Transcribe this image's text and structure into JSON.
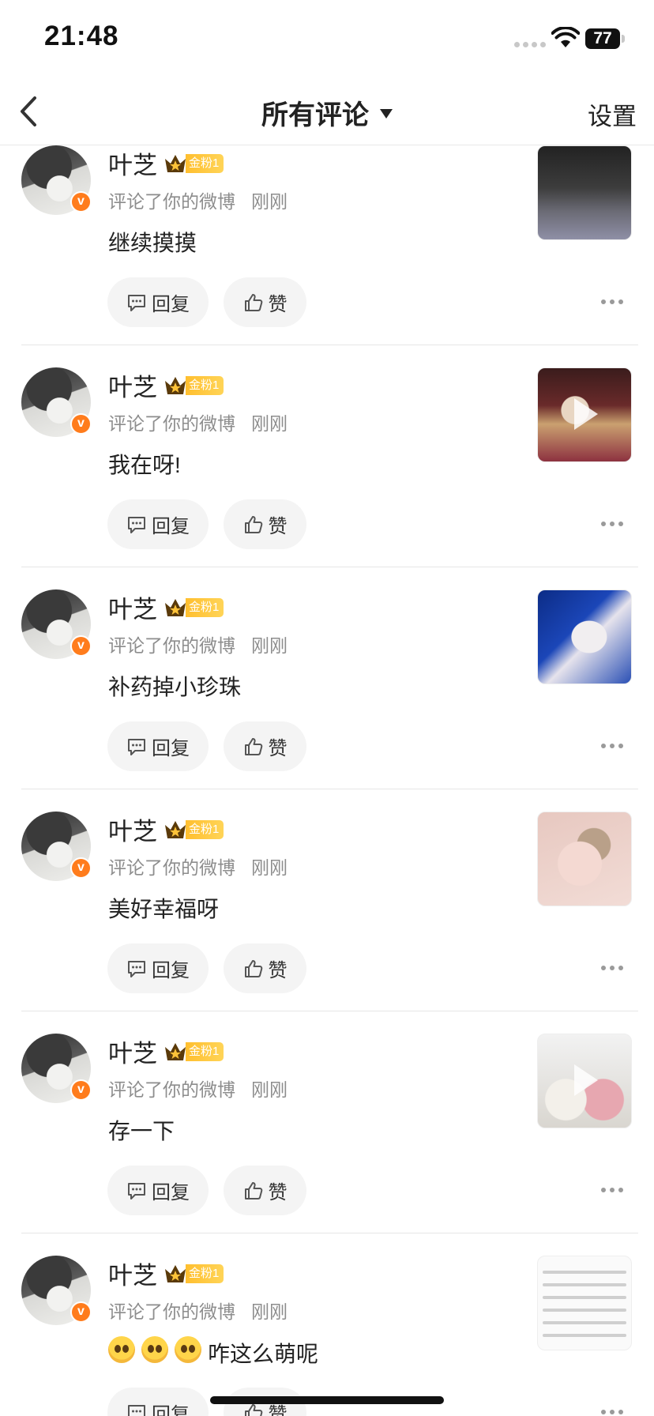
{
  "status_bar": {
    "time": "21:48",
    "battery": "77"
  },
  "nav": {
    "title": "所有评论",
    "settings_label": "设置"
  },
  "colors": {
    "verified_badge": "#ff7c1c",
    "fan_badge": "#ffc339",
    "meta_text": "#8d8d8d"
  },
  "comments": [
    {
      "user_name": "叶芝",
      "fan_badge": "金粉1",
      "action": "评论了你的微博",
      "time": "刚刚",
      "text": "继续摸摸",
      "reply_label": "回复",
      "like_label": "赞",
      "thumbnail": "concert-hands-photo",
      "has_video": false
    },
    {
      "user_name": "叶芝",
      "fan_badge": "金粉1",
      "action": "评论了你的微博",
      "time": "刚刚",
      "text": "我在呀!",
      "reply_label": "回复",
      "like_label": "赞",
      "thumbnail": "stage-hands-video",
      "has_video": true
    },
    {
      "user_name": "叶芝",
      "fan_badge": "金粉1",
      "action": "评论了你的微博",
      "time": "刚刚",
      "text": "补药掉小珍珠",
      "reply_label": "回复",
      "like_label": "赞",
      "thumbnail": "singer-on-stage-photo",
      "has_video": false
    },
    {
      "user_name": "叶芝",
      "fan_badge": "金粉1",
      "action": "评论了你的微博",
      "time": "刚刚",
      "text": "美好幸福呀",
      "reply_label": "回复",
      "like_label": "赞",
      "thumbnail": "kitten-photo",
      "has_video": false
    },
    {
      "user_name": "叶芝",
      "fan_badge": "金粉1",
      "action": "评论了你的微博",
      "time": "刚刚",
      "text": "存一下",
      "reply_label": "回复",
      "like_label": "赞",
      "thumbnail": "two-people-video",
      "has_video": true
    },
    {
      "user_name": "叶芝",
      "fan_badge": "金粉1",
      "action": "评论了你的微博",
      "time": "刚刚",
      "text": "咋这么萌呢",
      "emoji_prefix": [
        "pleading-face",
        "pleading-face",
        "pleading-face"
      ],
      "reply_label": "回复",
      "like_label": "赞",
      "thumbnail": "text-screenshot",
      "has_video": false
    }
  ]
}
